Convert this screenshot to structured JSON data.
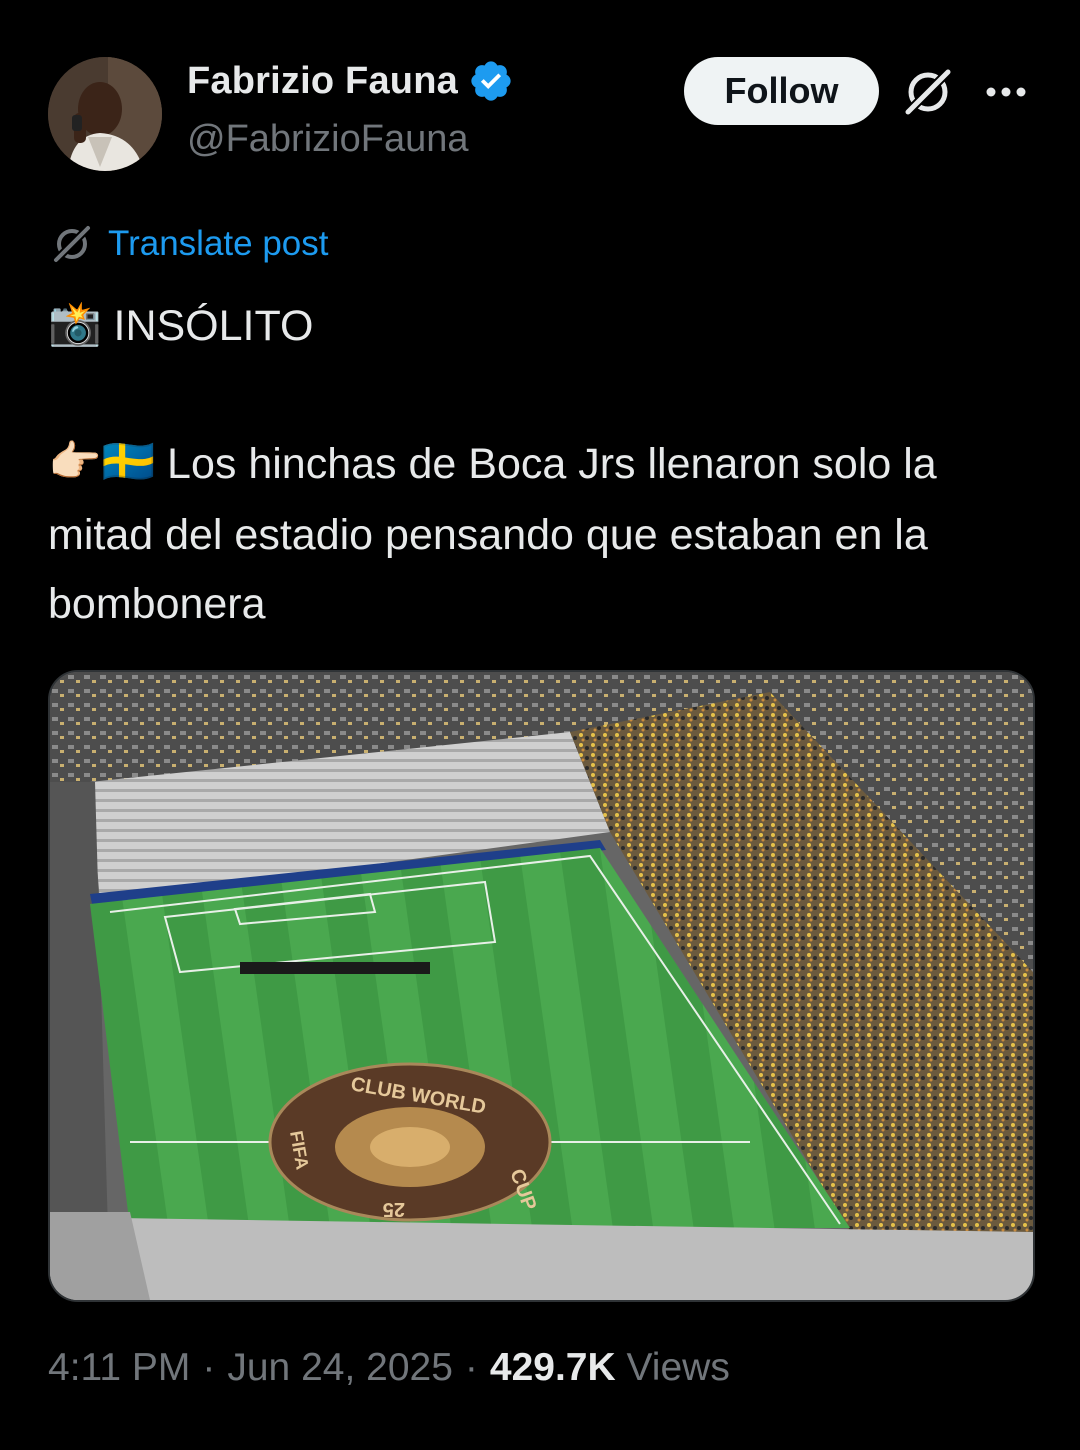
{
  "author": {
    "display_name": "Fabrizio Fauna",
    "handle": "@FabrizioFauna",
    "verified": true
  },
  "actions": {
    "follow_label": "Follow",
    "icons": [
      "grok-icon",
      "more-icon"
    ]
  },
  "translate": {
    "label": "Translate post"
  },
  "post": {
    "line1_emoji": "📸",
    "line1_text": "INSÓLITO",
    "line2_emoji": "👉🏻🇸🇪",
    "line2_text": "Los hinchas de Boca Jrs llenaron solo la mitad del estadio pensando que estaban en la bombonera"
  },
  "media": {
    "logo_text_top": "CLUB WORLD",
    "logo_text_right": "CUP",
    "logo_text_left": "FIFA",
    "logo_text_bottom": "25"
  },
  "meta": {
    "time": "4:11 PM",
    "separator": "·",
    "date": "Jun 24, 2025",
    "views_count": "429.7K",
    "views_label": "Views"
  },
  "colors": {
    "background": "#000000",
    "text": "#e7e9ea",
    "muted": "#71767b",
    "link": "#1d9bf0",
    "verified": "#1d9bf0"
  }
}
